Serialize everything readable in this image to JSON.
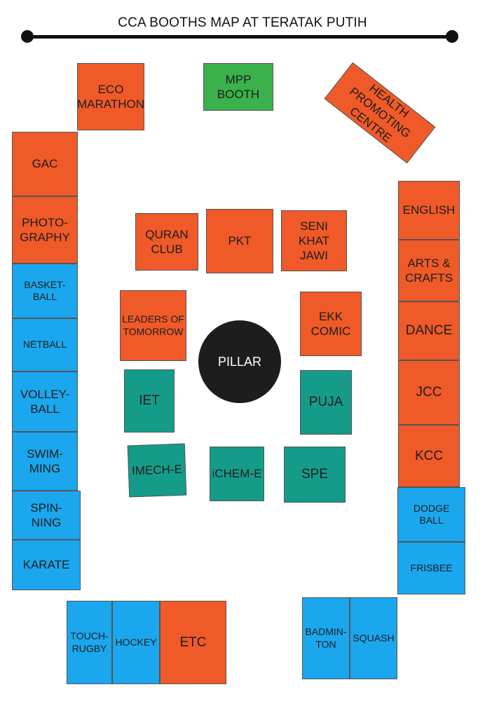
{
  "title": "CCA BOOTHS MAP AT TERATAK PUTIH",
  "colors": {
    "red": "#ef5a28",
    "blue": "#1aa7ee",
    "teal": "#159b8a",
    "green": "#3ab14a",
    "pillar": "#1d1d1d"
  },
  "booths": {
    "eco_marathon": "ECO\nMARATHON",
    "mpp_booth": "MPP\nBOOTH",
    "health_promoting_centre": "HEALTH\nPROMOTING\nCENTRE",
    "gac": "GAC",
    "photography": "PHOTO-\nGRAPHY",
    "basketball": "BASKET-\nBALL",
    "netball": "NETBALL",
    "volleyball": "VOLLEY-\nBALL",
    "swimming": "SWIM-\nMING",
    "spinning": "SPIN-\nNING",
    "karate": "KARATE",
    "quran_club": "QURAN\nCLUB",
    "pkt": "PKT",
    "seni_khat_jawi": "SENI\nKHAT\nJAWI",
    "leaders_of_tomorrow": "LEADERS OF\nTOMORROW",
    "ekk_comic": "EKK\nCOMIC",
    "iet": "IET",
    "puja": "PUJA",
    "imech_e": "IMECH-E",
    "ichem_e": "iCHEM-E",
    "spe": "SPE",
    "english": "ENGLISH",
    "arts_crafts": "ARTS &\nCRAFTS",
    "dance": "DANCE",
    "jcc": "JCC",
    "kcc": "KCC",
    "dodge_ball": "DODGE\nBALL",
    "frisbee": "FRISBEE",
    "touch_rugby": "TOUCH-\nRUGBY",
    "hockey": "HOCKEY",
    "etc": "ETC",
    "badminton": "BADMIN-\nTON",
    "squash": "SQUASH"
  },
  "pillar_label": "PILLAR"
}
